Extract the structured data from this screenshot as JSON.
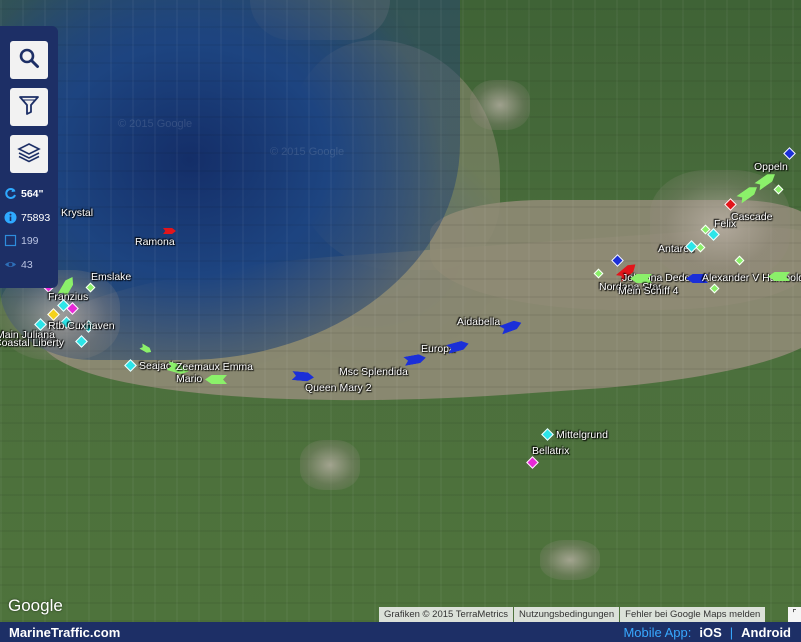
{
  "controls": {
    "search_icon": "search-icon",
    "filter_icon": "filter-icon",
    "layers_icon": "layers-icon"
  },
  "stats": {
    "refresh": "564\"",
    "vessels_total": "75893",
    "in_view": "199",
    "visible": "43"
  },
  "vessels": [
    {
      "name": "Oppeln",
      "color": "#1b2fd8"
    },
    {
      "name": "Cascade",
      "color": "#e2151b"
    },
    {
      "name": "Felix",
      "color": "#2ce5e8"
    },
    {
      "name": "Antares",
      "color": "#2ce5e8"
    },
    {
      "name": "Johanna Dede",
      "color": "#8bf06a"
    },
    {
      "name": "Alexander V Humboldt",
      "color": "#1b2fd8"
    },
    {
      "name": "Nordana Star",
      "color": "#e2151b"
    },
    {
      "name": "Mein Schiff 4",
      "color": "#1b2fd8"
    },
    {
      "name": "Aidabella",
      "color": "#1b2fd8"
    },
    {
      "name": "Europa",
      "color": "#1b2fd8"
    },
    {
      "name": "Msc Splendida",
      "color": "#1b2fd8"
    },
    {
      "name": "Queen Mary 2",
      "color": "#1b2fd8"
    },
    {
      "name": "Mittelgrund",
      "color": "#2ce5e8"
    },
    {
      "name": "Bellatrix",
      "color": "#e829d8"
    },
    {
      "name": "Krystal",
      "color": "#2ce5e8"
    },
    {
      "name": "Ramona",
      "color": "#e2151b"
    },
    {
      "name": "Emslake",
      "color": "#8bf06a"
    },
    {
      "name": "Franzius",
      "color": "#8bf06a"
    },
    {
      "name": "Rtb Cuxhaven",
      "color": "#2ce5e8"
    },
    {
      "name": "Main Juliana",
      "color": "#2ce5e8"
    },
    {
      "name": "Coastal Liberty",
      "color": "#2ce5e8"
    },
    {
      "name": "Seajack",
      "color": "#2ce5e8"
    },
    {
      "name": "Zeemaux Emma",
      "color": "#8bf06a"
    },
    {
      "name": "Mario",
      "color": "#8bf06a"
    }
  ],
  "map": {
    "google_logo": "Google",
    "attribution": "Grafiken © 2015 TerraMetrics",
    "terms": "Nutzungsbedingungen",
    "report": "Fehler bei Google Maps melden",
    "watermark": "© 2015 Google"
  },
  "footer": {
    "brand": "MarineTraffic.com",
    "mobile_label": "Mobile App:",
    "ios": "iOS",
    "separator": "|",
    "android": "Android"
  }
}
